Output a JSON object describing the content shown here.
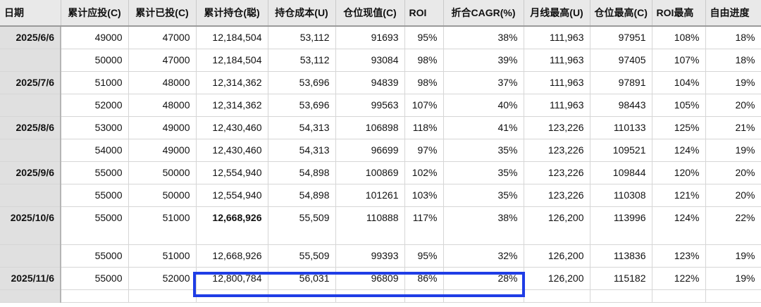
{
  "headers": [
    "日期",
    "累计应投(C)",
    "累计已投(C)",
    "累计持仓(聪)",
    "持仓成本(U)",
    "仓位现值(C)",
    "ROI",
    "折合CAGR(%)",
    "月线最高(U)",
    "仓位最高(C)",
    "ROI最高",
    "自由进度"
  ],
  "rows": [
    {
      "date": "2025/6/6",
      "cells": [
        "49000",
        "47000",
        "12,184,504",
        "53,112",
        "91693",
        "95%",
        "38%",
        "111,963",
        "97951",
        "108%",
        "18%"
      ]
    },
    {
      "date": "",
      "cells": [
        "50000",
        "47000",
        "12,184,504",
        "53,112",
        "93084",
        "98%",
        "39%",
        "111,963",
        "97405",
        "107%",
        "18%"
      ]
    },
    {
      "date": "2025/7/6",
      "cells": [
        "51000",
        "48000",
        "12,314,362",
        "53,696",
        "94839",
        "98%",
        "37%",
        "111,963",
        "97891",
        "104%",
        "19%"
      ]
    },
    {
      "date": "",
      "cells": [
        "52000",
        "48000",
        "12,314,362",
        "53,696",
        "99563",
        "107%",
        "40%",
        "111,963",
        "98443",
        "105%",
        "20%"
      ]
    },
    {
      "date": "2025/8/6",
      "cells": [
        "53000",
        "49000",
        "12,430,460",
        "54,313",
        "106898",
        "118%",
        "41%",
        "123,226",
        "110133",
        "125%",
        "21%"
      ]
    },
    {
      "date": "",
      "cells": [
        "54000",
        "49000",
        "12,430,460",
        "54,313",
        "96699",
        "97%",
        "35%",
        "123,226",
        "109521",
        "124%",
        "19%"
      ]
    },
    {
      "date": "2025/9/6",
      "cells": [
        "55000",
        "50000",
        "12,554,940",
        "54,898",
        "100869",
        "102%",
        "35%",
        "123,226",
        "109844",
        "120%",
        "20%"
      ]
    },
    {
      "date": "",
      "cells": [
        "55000",
        "50000",
        "12,554,940",
        "54,898",
        "101261",
        "103%",
        "35%",
        "123,226",
        "110308",
        "121%",
        "20%"
      ]
    },
    {
      "date": "2025/10/6",
      "cells": [
        "55000",
        "51000",
        "12,668,926",
        "55,509",
        "110888",
        "117%",
        "38%",
        "126,200",
        "113996",
        "124%",
        "22%"
      ]
    },
    {
      "date": "",
      "cells": [
        "55000",
        "51000",
        "12,668,926",
        "55,509",
        "99393",
        "95%",
        "32%",
        "126,200",
        "113836",
        "123%",
        "19%"
      ]
    },
    {
      "date": "2025/11/6",
      "cells": [
        "55000",
        "52000",
        "12,800,784",
        "56,031",
        "96809",
        "86%",
        "28%",
        "126,200",
        "115182",
        "122%",
        "19%"
      ]
    }
  ],
  "highlight_color": "#1f3de6"
}
